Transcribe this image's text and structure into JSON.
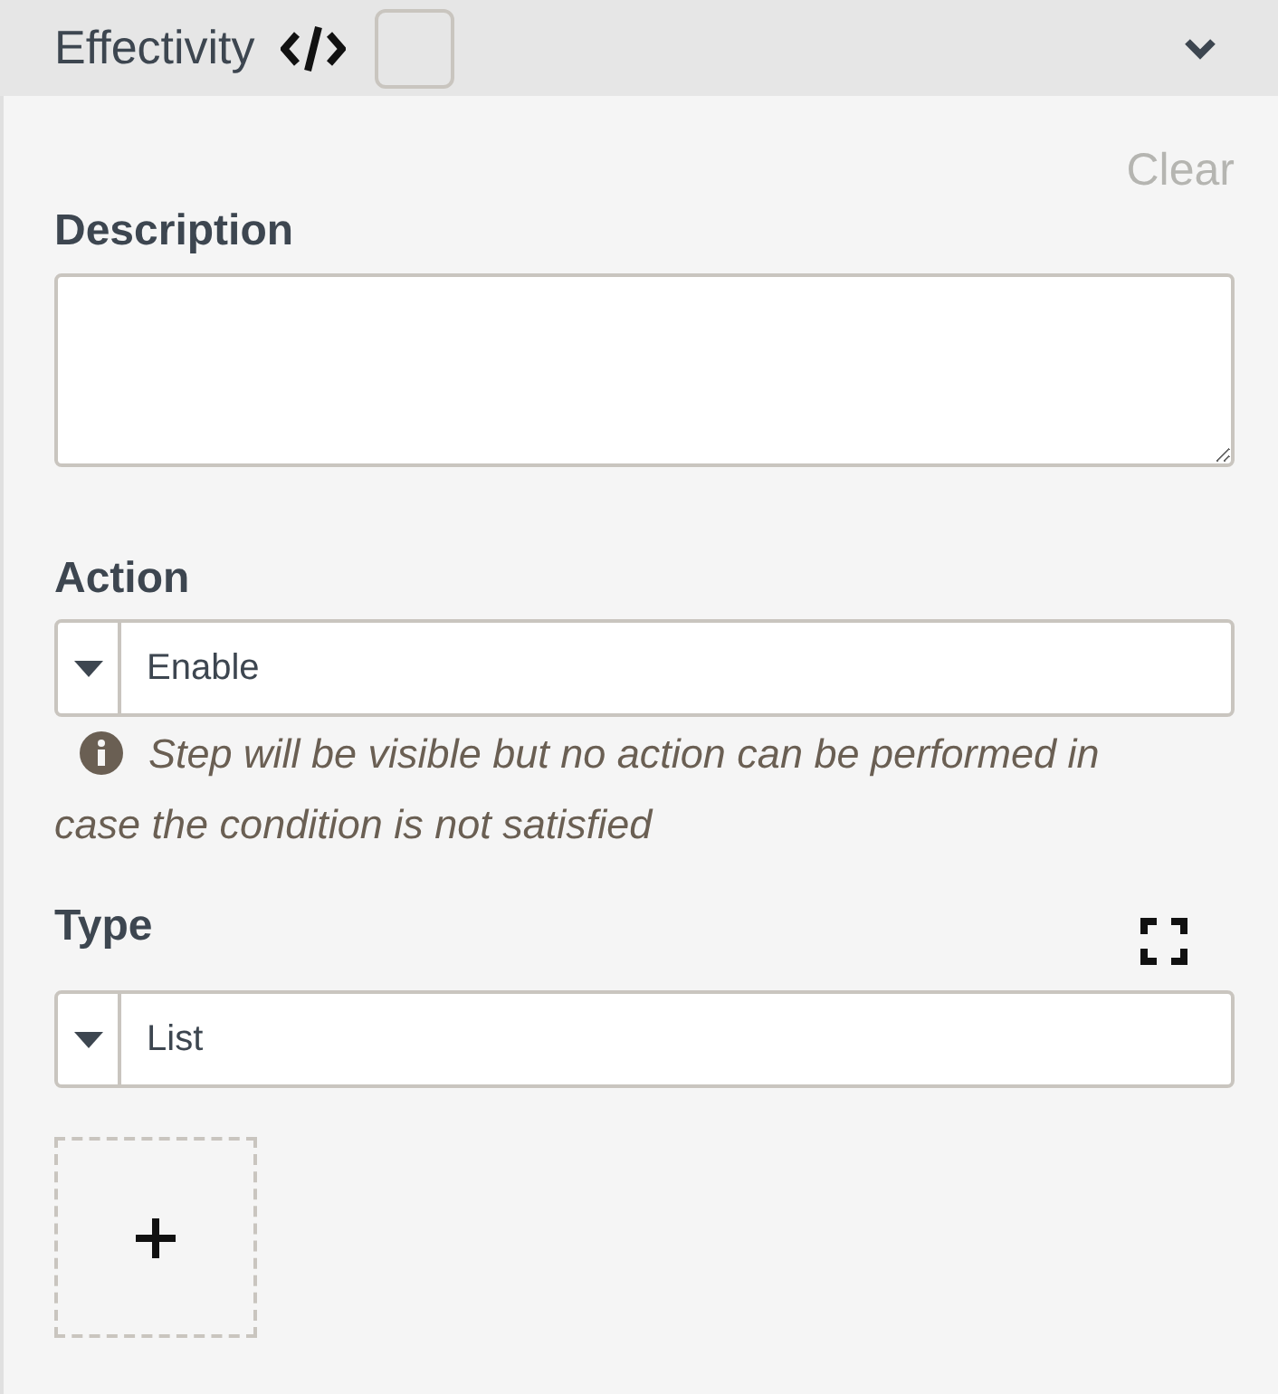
{
  "header": {
    "title": "Effectivity",
    "checked": false,
    "expanded": true
  },
  "clear_button": "Clear",
  "description": {
    "label": "Description"
  },
  "action": {
    "label": "Action",
    "value": "Enable",
    "hint": "Step will be visible but no action can be performed in case the condition is not satisfied"
  },
  "type": {
    "label": "Type",
    "value": "List"
  }
}
